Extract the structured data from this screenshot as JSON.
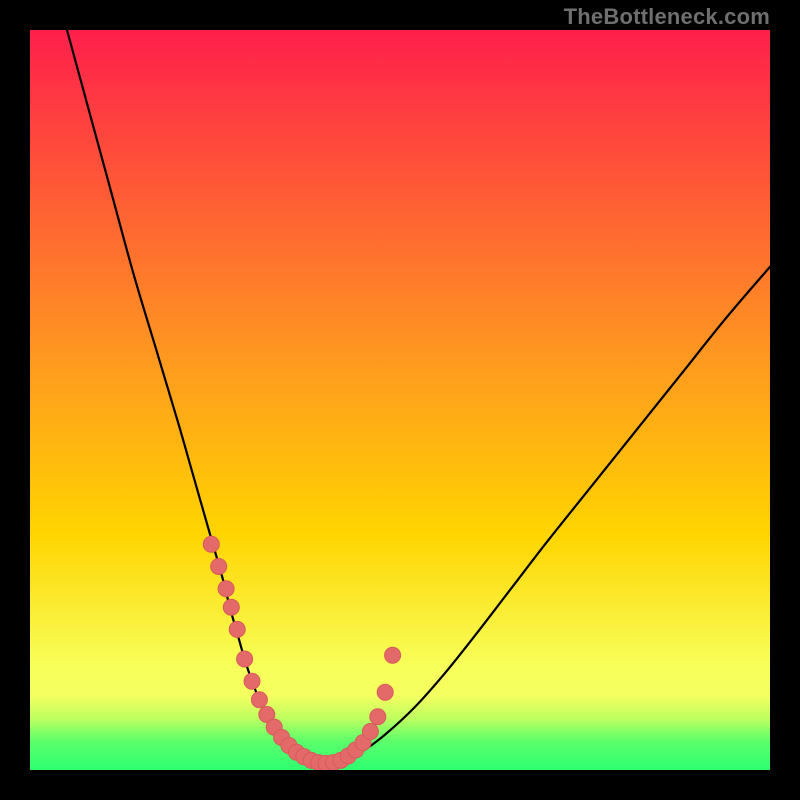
{
  "watermark": "TheBottleneck.com",
  "colors": {
    "frame": "#000000",
    "grad_top": "#ff1f4b",
    "grad_mid": "#ffd400",
    "grad_green_band_top": "#f4ff60",
    "grad_green_band": "#2fff70",
    "curve": "#000000",
    "marker_fill": "#e46a6a",
    "marker_stroke": "#d85a5a"
  },
  "chart_data": {
    "type": "line",
    "title": "",
    "xlabel": "",
    "ylabel": "",
    "xlim": [
      0,
      100
    ],
    "ylim": [
      0,
      100
    ],
    "x": [
      5,
      8,
      11,
      14,
      17,
      20,
      22,
      24,
      26,
      27,
      28,
      29,
      30,
      31,
      32,
      33,
      34,
      35,
      36,
      38,
      40,
      42,
      45,
      48,
      52,
      56,
      60,
      65,
      70,
      76,
      82,
      88,
      94,
      100
    ],
    "y": [
      100,
      89,
      78,
      67,
      57,
      47,
      40,
      33,
      26,
      22,
      18.5,
      15,
      12,
      9.5,
      7.5,
      5.8,
      4.4,
      3.3,
      2.4,
      1.3,
      0.9,
      1.3,
      2.6,
      4.8,
      8.5,
      13,
      18,
      24.5,
      31,
      38.5,
      46,
      53.5,
      61,
      68
    ],
    "markers": {
      "x": [
        24.5,
        25.5,
        26.5,
        27.2,
        28.0,
        29.0,
        30.0,
        31.0,
        32.0,
        33.0,
        34.0,
        35.0,
        36.0,
        37.0,
        38.0,
        39.0,
        40.0,
        41.0,
        42.0,
        43.0,
        44.0,
        45.0,
        46.0,
        47.0,
        48.0,
        49.0
      ],
      "y": [
        30.5,
        27.5,
        24.5,
        22.0,
        19.0,
        15.0,
        12.0,
        9.5,
        7.5,
        5.8,
        4.4,
        3.3,
        2.4,
        1.8,
        1.3,
        1.0,
        0.9,
        1.0,
        1.3,
        1.9,
        2.7,
        3.7,
        5.2,
        7.2,
        10.5,
        15.5
      ]
    }
  }
}
